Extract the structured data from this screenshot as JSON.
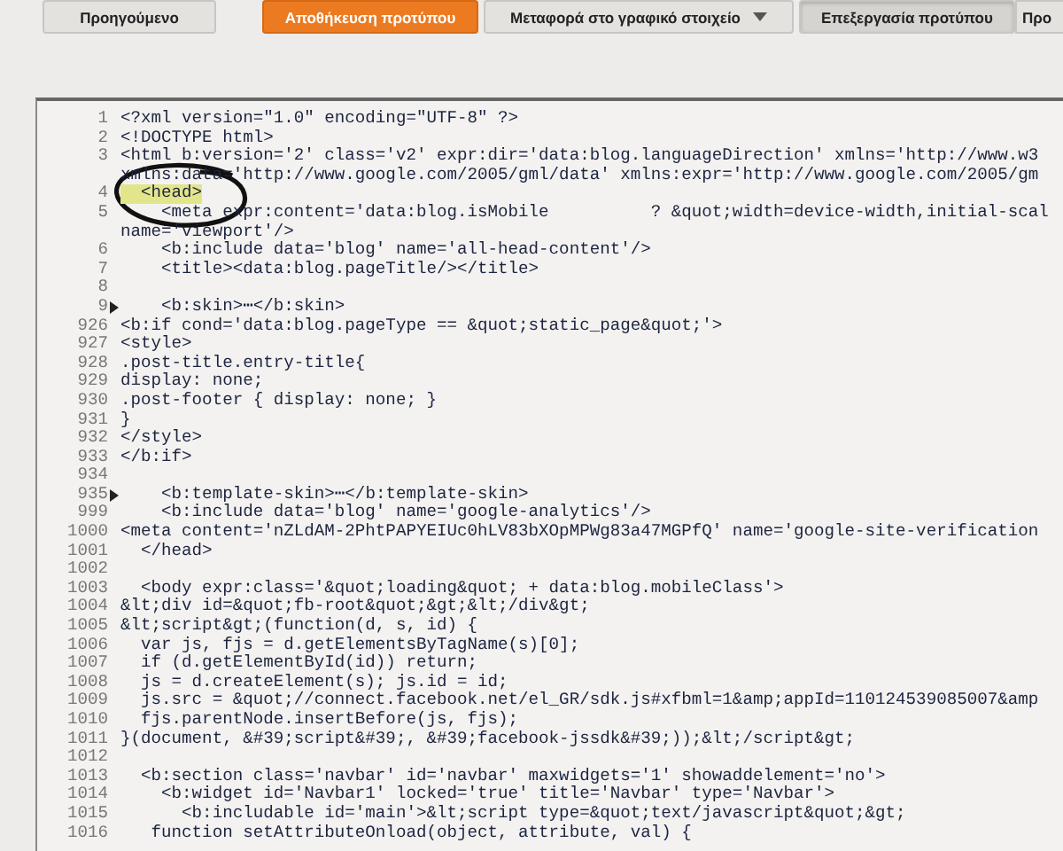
{
  "toolbar": {
    "buttons": [
      {
        "label": "Προηγούμενο",
        "kind": "plain",
        "pressed": false
      },
      {
        "label": "Αποθήκευση προτύπου",
        "kind": "primary",
        "pressed": false
      },
      {
        "label": "Μεταφορά στο γραφικό στοιχείο",
        "kind": "dropdown",
        "pressed": false
      },
      {
        "label": "Επεξεργασία προτύπου",
        "kind": "plain",
        "pressed": true
      },
      {
        "label": "Προ",
        "kind": "plain",
        "pressed": false
      }
    ]
  },
  "editor": {
    "lines": [
      {
        "number": "1",
        "text": "<?xml version=\"1.0\" encoding=\"UTF-8\" ?>",
        "folded": false,
        "highlighted": false
      },
      {
        "number": "2",
        "text": "<!DOCTYPE html>",
        "folded": false,
        "highlighted": false
      },
      {
        "number": "3",
        "text": "<html b:version='2' class='v2' expr:dir='data:blog.languageDirection' xmlns='http://www.w3",
        "folded": false,
        "highlighted": false
      },
      {
        "text": "xmlns:data='http://www.google.com/2005/gml/data' xmlns:expr='http://www.google.com/2005/gm",
        "folded": false,
        "highlighted": false
      },
      {
        "number": "4",
        "text": "  <head>",
        "folded": false,
        "highlighted": true
      },
      {
        "number": "5",
        "text": "    <meta expr:content='data:blog.isMobile          ? &quot;width=device-width,initial-scal",
        "folded": false,
        "highlighted": false
      },
      {
        "text": "name='viewport'/>",
        "folded": false,
        "highlighted": false
      },
      {
        "number": "6",
        "text": "    <b:include data='blog' name='all-head-content'/>",
        "folded": false,
        "highlighted": false
      },
      {
        "number": "7",
        "text": "    <title><data:blog.pageTitle/></title>",
        "folded": false,
        "highlighted": false
      },
      {
        "number": "8",
        "folded": false,
        "highlighted": false
      },
      {
        "number": "9",
        "text": "    <b:skin>⋯</b:skin>",
        "folded": true,
        "highlighted": false
      },
      {
        "number": "926",
        "text": "<b:if cond='data:blog.pageType == &quot;static_page&quot;'>",
        "folded": false,
        "highlighted": false
      },
      {
        "number": "927",
        "text": "<style>",
        "folded": false,
        "highlighted": false
      },
      {
        "number": "928",
        "text": ".post-title.entry-title{",
        "folded": false,
        "highlighted": false
      },
      {
        "number": "929",
        "text": "display: none;",
        "folded": false,
        "highlighted": false
      },
      {
        "number": "930",
        "text": ".post-footer { display: none; }",
        "folded": false,
        "highlighted": false
      },
      {
        "number": "931",
        "text": "}",
        "folded": false,
        "highlighted": false
      },
      {
        "number": "932",
        "text": "</style>",
        "folded": false,
        "highlighted": false
      },
      {
        "number": "933",
        "text": "</b:if>",
        "folded": false,
        "highlighted": false
      },
      {
        "number": "934",
        "folded": false,
        "highlighted": false
      },
      {
        "number": "935",
        "text": "    <b:template-skin>⋯</b:template-skin>",
        "folded": true,
        "highlighted": false
      },
      {
        "number": "999",
        "text": "    <b:include data='blog' name='google-analytics'/>",
        "folded": false,
        "highlighted": false
      },
      {
        "number": "1000",
        "text": "<meta content='nZLdAM-2PhtPAPYEIUc0hLV83bXOpMPWg83a47MGPfQ' name='google-site-verification",
        "folded": false,
        "highlighted": false
      },
      {
        "number": "1001",
        "text": "  </head>",
        "folded": false,
        "highlighted": false
      },
      {
        "number": "1002",
        "folded": false,
        "highlighted": false
      },
      {
        "number": "1003",
        "text": "  <body expr:class='&quot;loading&quot; + data:blog.mobileClass'>",
        "folded": false,
        "highlighted": false
      },
      {
        "number": "1004",
        "text": "&lt;div id=&quot;fb-root&quot;&gt;&lt;/div&gt;",
        "folded": false,
        "highlighted": false
      },
      {
        "number": "1005",
        "text": "&lt;script&gt;(function(d, s, id) {",
        "folded": false,
        "highlighted": false
      },
      {
        "number": "1006",
        "text": "  var js, fjs = d.getElementsByTagName(s)[0];",
        "folded": false,
        "highlighted": false
      },
      {
        "number": "1007",
        "text": "  if (d.getElementById(id)) return;",
        "folded": false,
        "highlighted": false
      },
      {
        "number": "1008",
        "text": "  js = d.createElement(s); js.id = id;",
        "folded": false,
        "highlighted": false
      },
      {
        "number": "1009",
        "text": "  js.src = &quot;//connect.facebook.net/el_GR/sdk.js#xfbml=1&amp;appId=110124539085007&amp",
        "folded": false,
        "highlighted": false
      },
      {
        "number": "1010",
        "text": "  fjs.parentNode.insertBefore(js, fjs);",
        "folded": false,
        "highlighted": false
      },
      {
        "number": "1011",
        "text": "}(document, &#39;script&#39;, &#39;facebook-jssdk&#39;));&lt;/script&gt;",
        "folded": false,
        "highlighted": false
      },
      {
        "number": "1012",
        "folded": false,
        "highlighted": false
      },
      {
        "number": "1013",
        "text": "  <b:section class='navbar' id='navbar' maxwidgets='1' showaddelement='no'>",
        "folded": false,
        "highlighted": false
      },
      {
        "number": "1014",
        "text": "    <b:widget id='Navbar1' locked='true' title='Navbar' type='Navbar'>",
        "folded": false,
        "highlighted": false
      },
      {
        "number": "1015",
        "text": "      <b:includable id='main'>&lt;script type=&quot;text/javascript&quot;&gt;",
        "folded": false,
        "highlighted": false
      },
      {
        "number": "1016",
        "text": "   function setAttributeOnload(object, attribute, val) {",
        "folded": false,
        "highlighted": false
      }
    ]
  }
}
